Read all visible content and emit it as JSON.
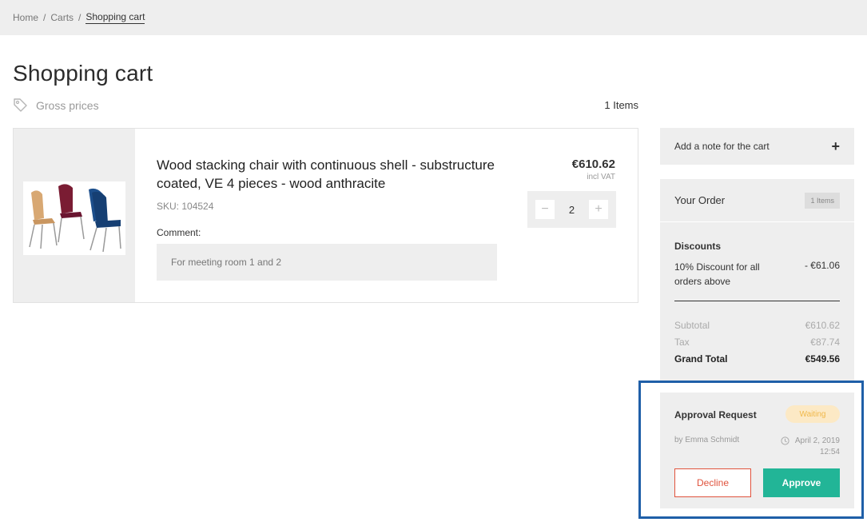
{
  "breadcrumb": {
    "items": [
      "Home",
      "Carts",
      "Shopping cart"
    ],
    "separator": "/"
  },
  "page": {
    "title": "Shopping cart",
    "price_type": "Gross prices",
    "items_count": "1 Items"
  },
  "cart_item": {
    "name": "Wood stacking chair with continuous shell - substructure coated, VE 4 pieces - wood anthracite",
    "sku": "SKU: 104524",
    "comment_label": "Comment:",
    "comment": "For meeting room 1 and 2",
    "price": "€610.62",
    "vat_note": "incl VAT",
    "quantity": "2",
    "minus": "−",
    "plus": "+"
  },
  "sidebar": {
    "note": {
      "label": "Add a note for the cart",
      "icon": "+"
    },
    "order": {
      "title": "Your Order",
      "badge": "1 Items",
      "discounts_title": "Discounts",
      "discount_name": "10% Discount for all orders above",
      "discount_value": "- €61.06",
      "subtotal_label": "Subtotal",
      "subtotal_value": "€610.62",
      "tax_label": "Tax",
      "tax_value": "€87.74",
      "total_label": "Grand Total",
      "total_value": "€549.56"
    },
    "approval": {
      "title": "Approval Request",
      "status": "Waiting",
      "by": "by Emma Schmidt",
      "date": "April 2, 2019",
      "time": "12:54",
      "decline": "Decline",
      "approve": "Approve"
    }
  },
  "colors": {
    "accent_approve": "#22b597",
    "decline": "#e0533d",
    "waiting_bg": "#fce9c5",
    "waiting_text": "#f0b84a",
    "highlight_frame": "#1f5fa8"
  }
}
